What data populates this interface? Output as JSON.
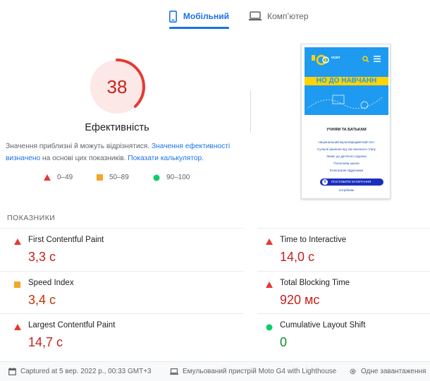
{
  "tabs": {
    "mobile_label": "Мобільний",
    "desktop_label": "Комп’ютер"
  },
  "score": {
    "value": "38",
    "fraction": 0.38,
    "title": "Ефективність",
    "color": "#c5221f",
    "bg_color": "#fce8e6"
  },
  "description": {
    "text1": "Значення приблизні й можуть відрізнятися.",
    "link1": "Значення ефективності визначено",
    "text2": "на основі цих показників.",
    "link2": "Показати калькулятор."
  },
  "legend": {
    "poor": "0–49",
    "average": "50–89",
    "good": "90–100"
  },
  "preview": {
    "logo_text": "освіт",
    "banner": "НО ДО НАВЧАНН",
    "menu_title": "УЧНЯМ ТА БАТЬКАМ",
    "links": [
      "Національний мультипредметний тест",
      "Сучасні рішення під час воєнного стану",
      "Запис до дитячого садочка",
      "Початкова школа",
      "Електронні підручники"
    ],
    "button": "ПОСТАВИТИ ЗАПИТАННЯ",
    "button_icon": "V",
    "bottom_link": "потрібним"
  },
  "metrics": {
    "header": "ПОКАЗНИКИ",
    "items": [
      {
        "name": "First Contentful Paint",
        "value": "3,3 с",
        "status": "poor"
      },
      {
        "name": "Time to Interactive",
        "value": "14,0 с",
        "status": "poor"
      },
      {
        "name": "Speed Index",
        "value": "3,4 с",
        "status": "average"
      },
      {
        "name": "Total Blocking Time",
        "value": "920 мс",
        "status": "poor"
      },
      {
        "name": "Largest Contentful Paint",
        "value": "14,7 с",
        "status": "poor"
      },
      {
        "name": "Cumulative Layout Shift",
        "value": "0",
        "status": "good"
      }
    ]
  },
  "footer": {
    "captured": "Captured at 5 вер. 2022 р., 00:33 GMT+3",
    "device": "Емульований пристрій Moto G4 with Lighthouse",
    "session": "Одне завантаження ",
    "icons": [
      "calendar-icon",
      "laptop-icon",
      "gear-icon"
    ]
  },
  "colors": {
    "accent": "#1a73e8",
    "poor": "#e53935",
    "average": "#f4a52a",
    "good": "#0cce6b"
  }
}
